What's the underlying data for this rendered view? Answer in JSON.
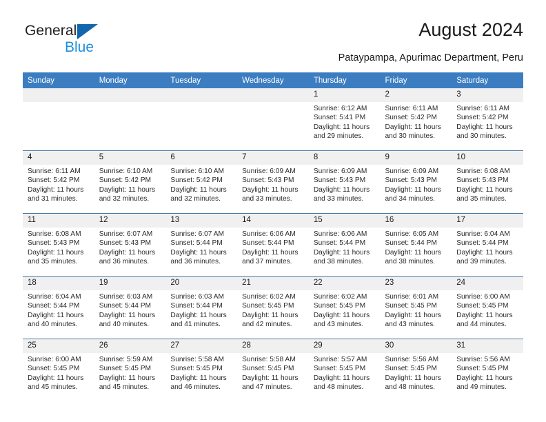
{
  "brand": {
    "line1": "General",
    "line2": "Blue",
    "accent_dark": "#1266ae",
    "accent_light": "#1f8fe0"
  },
  "header": {
    "title": "August 2024",
    "subtitle": "Pataypampa, Apurimac Department, Peru"
  },
  "theme": {
    "header_row_bg": "#3b7dc0",
    "daynum_bg": "#f0f0f0",
    "grid_line": "#4a79a8"
  },
  "weekdays": [
    "Sunday",
    "Monday",
    "Tuesday",
    "Wednesday",
    "Thursday",
    "Friday",
    "Saturday"
  ],
  "weeks": [
    [
      {
        "day": "",
        "sunrise": "",
        "sunset": "",
        "daylight1": "",
        "daylight2": "",
        "empty": true
      },
      {
        "day": "",
        "sunrise": "",
        "sunset": "",
        "daylight1": "",
        "daylight2": "",
        "empty": true
      },
      {
        "day": "",
        "sunrise": "",
        "sunset": "",
        "daylight1": "",
        "daylight2": "",
        "empty": true
      },
      {
        "day": "",
        "sunrise": "",
        "sunset": "",
        "daylight1": "",
        "daylight2": "",
        "empty": true
      },
      {
        "day": "1",
        "sunrise": "Sunrise: 6:12 AM",
        "sunset": "Sunset: 5:41 PM",
        "daylight1": "Daylight: 11 hours",
        "daylight2": "and 29 minutes."
      },
      {
        "day": "2",
        "sunrise": "Sunrise: 6:11 AM",
        "sunset": "Sunset: 5:42 PM",
        "daylight1": "Daylight: 11 hours",
        "daylight2": "and 30 minutes."
      },
      {
        "day": "3",
        "sunrise": "Sunrise: 6:11 AM",
        "sunset": "Sunset: 5:42 PM",
        "daylight1": "Daylight: 11 hours",
        "daylight2": "and 30 minutes."
      }
    ],
    [
      {
        "day": "4",
        "sunrise": "Sunrise: 6:11 AM",
        "sunset": "Sunset: 5:42 PM",
        "daylight1": "Daylight: 11 hours",
        "daylight2": "and 31 minutes."
      },
      {
        "day": "5",
        "sunrise": "Sunrise: 6:10 AM",
        "sunset": "Sunset: 5:42 PM",
        "daylight1": "Daylight: 11 hours",
        "daylight2": "and 32 minutes."
      },
      {
        "day": "6",
        "sunrise": "Sunrise: 6:10 AM",
        "sunset": "Sunset: 5:42 PM",
        "daylight1": "Daylight: 11 hours",
        "daylight2": "and 32 minutes."
      },
      {
        "day": "7",
        "sunrise": "Sunrise: 6:09 AM",
        "sunset": "Sunset: 5:43 PM",
        "daylight1": "Daylight: 11 hours",
        "daylight2": "and 33 minutes."
      },
      {
        "day": "8",
        "sunrise": "Sunrise: 6:09 AM",
        "sunset": "Sunset: 5:43 PM",
        "daylight1": "Daylight: 11 hours",
        "daylight2": "and 33 minutes."
      },
      {
        "day": "9",
        "sunrise": "Sunrise: 6:09 AM",
        "sunset": "Sunset: 5:43 PM",
        "daylight1": "Daylight: 11 hours",
        "daylight2": "and 34 minutes."
      },
      {
        "day": "10",
        "sunrise": "Sunrise: 6:08 AM",
        "sunset": "Sunset: 5:43 PM",
        "daylight1": "Daylight: 11 hours",
        "daylight2": "and 35 minutes."
      }
    ],
    [
      {
        "day": "11",
        "sunrise": "Sunrise: 6:08 AM",
        "sunset": "Sunset: 5:43 PM",
        "daylight1": "Daylight: 11 hours",
        "daylight2": "and 35 minutes."
      },
      {
        "day": "12",
        "sunrise": "Sunrise: 6:07 AM",
        "sunset": "Sunset: 5:43 PM",
        "daylight1": "Daylight: 11 hours",
        "daylight2": "and 36 minutes."
      },
      {
        "day": "13",
        "sunrise": "Sunrise: 6:07 AM",
        "sunset": "Sunset: 5:44 PM",
        "daylight1": "Daylight: 11 hours",
        "daylight2": "and 36 minutes."
      },
      {
        "day": "14",
        "sunrise": "Sunrise: 6:06 AM",
        "sunset": "Sunset: 5:44 PM",
        "daylight1": "Daylight: 11 hours",
        "daylight2": "and 37 minutes."
      },
      {
        "day": "15",
        "sunrise": "Sunrise: 6:06 AM",
        "sunset": "Sunset: 5:44 PM",
        "daylight1": "Daylight: 11 hours",
        "daylight2": "and 38 minutes."
      },
      {
        "day": "16",
        "sunrise": "Sunrise: 6:05 AM",
        "sunset": "Sunset: 5:44 PM",
        "daylight1": "Daylight: 11 hours",
        "daylight2": "and 38 minutes."
      },
      {
        "day": "17",
        "sunrise": "Sunrise: 6:04 AM",
        "sunset": "Sunset: 5:44 PM",
        "daylight1": "Daylight: 11 hours",
        "daylight2": "and 39 minutes."
      }
    ],
    [
      {
        "day": "18",
        "sunrise": "Sunrise: 6:04 AM",
        "sunset": "Sunset: 5:44 PM",
        "daylight1": "Daylight: 11 hours",
        "daylight2": "and 40 minutes."
      },
      {
        "day": "19",
        "sunrise": "Sunrise: 6:03 AM",
        "sunset": "Sunset: 5:44 PM",
        "daylight1": "Daylight: 11 hours",
        "daylight2": "and 40 minutes."
      },
      {
        "day": "20",
        "sunrise": "Sunrise: 6:03 AM",
        "sunset": "Sunset: 5:44 PM",
        "daylight1": "Daylight: 11 hours",
        "daylight2": "and 41 minutes."
      },
      {
        "day": "21",
        "sunrise": "Sunrise: 6:02 AM",
        "sunset": "Sunset: 5:45 PM",
        "daylight1": "Daylight: 11 hours",
        "daylight2": "and 42 minutes."
      },
      {
        "day": "22",
        "sunrise": "Sunrise: 6:02 AM",
        "sunset": "Sunset: 5:45 PM",
        "daylight1": "Daylight: 11 hours",
        "daylight2": "and 43 minutes."
      },
      {
        "day": "23",
        "sunrise": "Sunrise: 6:01 AM",
        "sunset": "Sunset: 5:45 PM",
        "daylight1": "Daylight: 11 hours",
        "daylight2": "and 43 minutes."
      },
      {
        "day": "24",
        "sunrise": "Sunrise: 6:00 AM",
        "sunset": "Sunset: 5:45 PM",
        "daylight1": "Daylight: 11 hours",
        "daylight2": "and 44 minutes."
      }
    ],
    [
      {
        "day": "25",
        "sunrise": "Sunrise: 6:00 AM",
        "sunset": "Sunset: 5:45 PM",
        "daylight1": "Daylight: 11 hours",
        "daylight2": "and 45 minutes."
      },
      {
        "day": "26",
        "sunrise": "Sunrise: 5:59 AM",
        "sunset": "Sunset: 5:45 PM",
        "daylight1": "Daylight: 11 hours",
        "daylight2": "and 45 minutes."
      },
      {
        "day": "27",
        "sunrise": "Sunrise: 5:58 AM",
        "sunset": "Sunset: 5:45 PM",
        "daylight1": "Daylight: 11 hours",
        "daylight2": "and 46 minutes."
      },
      {
        "day": "28",
        "sunrise": "Sunrise: 5:58 AM",
        "sunset": "Sunset: 5:45 PM",
        "daylight1": "Daylight: 11 hours",
        "daylight2": "and 47 minutes."
      },
      {
        "day": "29",
        "sunrise": "Sunrise: 5:57 AM",
        "sunset": "Sunset: 5:45 PM",
        "daylight1": "Daylight: 11 hours",
        "daylight2": "and 48 minutes."
      },
      {
        "day": "30",
        "sunrise": "Sunrise: 5:56 AM",
        "sunset": "Sunset: 5:45 PM",
        "daylight1": "Daylight: 11 hours",
        "daylight2": "and 48 minutes."
      },
      {
        "day": "31",
        "sunrise": "Sunrise: 5:56 AM",
        "sunset": "Sunset: 5:45 PM",
        "daylight1": "Daylight: 11 hours",
        "daylight2": "and 49 minutes."
      }
    ]
  ]
}
